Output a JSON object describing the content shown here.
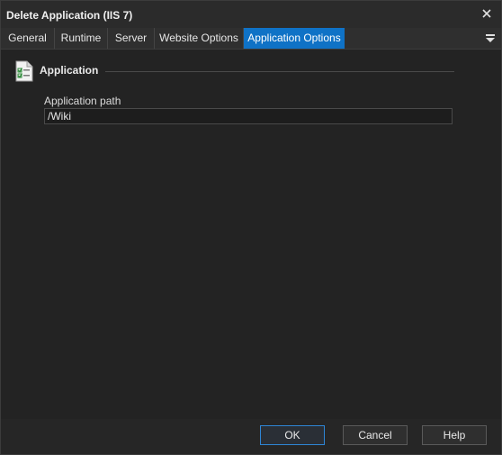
{
  "window": {
    "title": "Delete Application (IIS 7)"
  },
  "tabs": [
    {
      "label": "General",
      "active": false
    },
    {
      "label": "Runtime",
      "active": false
    },
    {
      "label": "Server",
      "active": false
    },
    {
      "label": "Website Options",
      "active": false
    },
    {
      "label": "Application Options",
      "active": true
    }
  ],
  "group": {
    "title": "Application",
    "icon": "checklist-document-icon"
  },
  "fields": {
    "application_path": {
      "label": "Application path",
      "value": "/Wiki"
    }
  },
  "buttons": {
    "ok": "OK",
    "cancel": "Cancel",
    "help": "Help"
  },
  "colors": {
    "accent": "#0f72c6",
    "background": "#232323"
  }
}
